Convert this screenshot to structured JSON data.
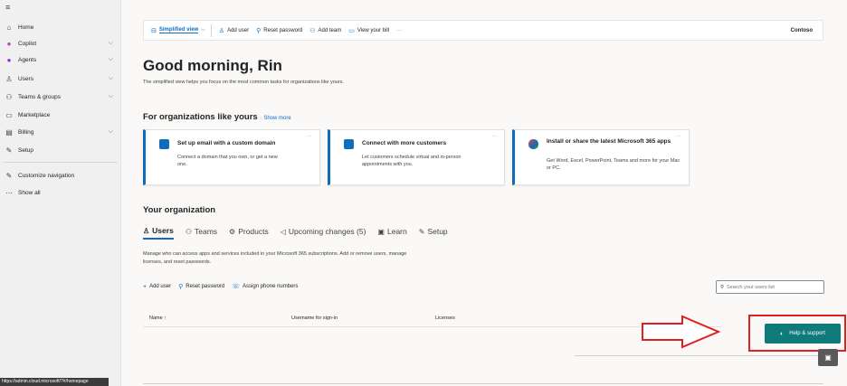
{
  "nav": {
    "items": [
      {
        "icon": "home-icon",
        "glyph": "⌂",
        "label": "Home",
        "chevron": false
      },
      {
        "icon": "copilot-icon",
        "glyph": "●",
        "label": "Copilot",
        "chevron": true
      },
      {
        "icon": "agents-icon",
        "glyph": "●",
        "label": "Agents",
        "chevron": true
      },
      {
        "icon": "user-icon",
        "glyph": "♙",
        "label": "Users",
        "chevron": true
      },
      {
        "icon": "teams-groups-icon",
        "glyph": "⚇",
        "label": "Teams & groups",
        "chevron": true
      },
      {
        "icon": "marketplace-icon",
        "glyph": "▭",
        "label": "Marketplace",
        "chevron": false
      },
      {
        "icon": "billing-icon",
        "glyph": "▤",
        "label": "Billing",
        "chevron": true
      },
      {
        "icon": "setup-icon",
        "glyph": "✎",
        "label": "Setup",
        "chevron": false
      },
      {
        "icon": "customize-icon",
        "glyph": "✎",
        "label": "Customize navigation",
        "chevron": false
      },
      {
        "icon": "more-icon",
        "glyph": "⋯",
        "label": "Show all",
        "chevron": false
      }
    ]
  },
  "command_bar": {
    "simplified_view": "Simplified view",
    "add_user": "Add user",
    "reset_password": "Reset password",
    "add_team": "Add team",
    "view_bill": "View your bill",
    "more": "···",
    "org": "Contoso"
  },
  "greeting": "Good morning, Rin",
  "subtitle": "The simplified view helps you focus on the most common tasks for organizations like yours.",
  "for_orgs": {
    "title": "For organizations like yours",
    "show_more": "Show more"
  },
  "cards": [
    {
      "title": "Set up email with a custom domain",
      "desc": "Connect a domain that you own, or get a new one.",
      "color": "#0f6cbd"
    },
    {
      "title": "Connect with more customers",
      "desc": "Let customers schedule virtual and in-person appointments with you.",
      "color": "#106ebe"
    },
    {
      "title": "Install or share the latest Microsoft 365 apps",
      "desc": "Get Word, Excel, PowerPoint, Teams and more for your Mac or PC.",
      "color": "#e8453c"
    }
  ],
  "your_org": {
    "title": "Your organization",
    "tabs": [
      "Users",
      "Teams",
      "Products",
      "Upcoming changes (5)",
      "Learn",
      "Setup"
    ],
    "desc": "Manage who can access apps and services included in your Microsoft 365 subscriptions. Add or remove users, manage licenses, and reset passwords.",
    "actions": [
      "Add user",
      "Reset password",
      "Assign phone numbers"
    ],
    "search_placeholder": "Search your users list",
    "columns": [
      "Name ↑",
      "Username for sign-in",
      "Licenses"
    ]
  },
  "help_support": "Help & support",
  "status_url": "https://admin.cloud.microsoft/?#/homepage"
}
